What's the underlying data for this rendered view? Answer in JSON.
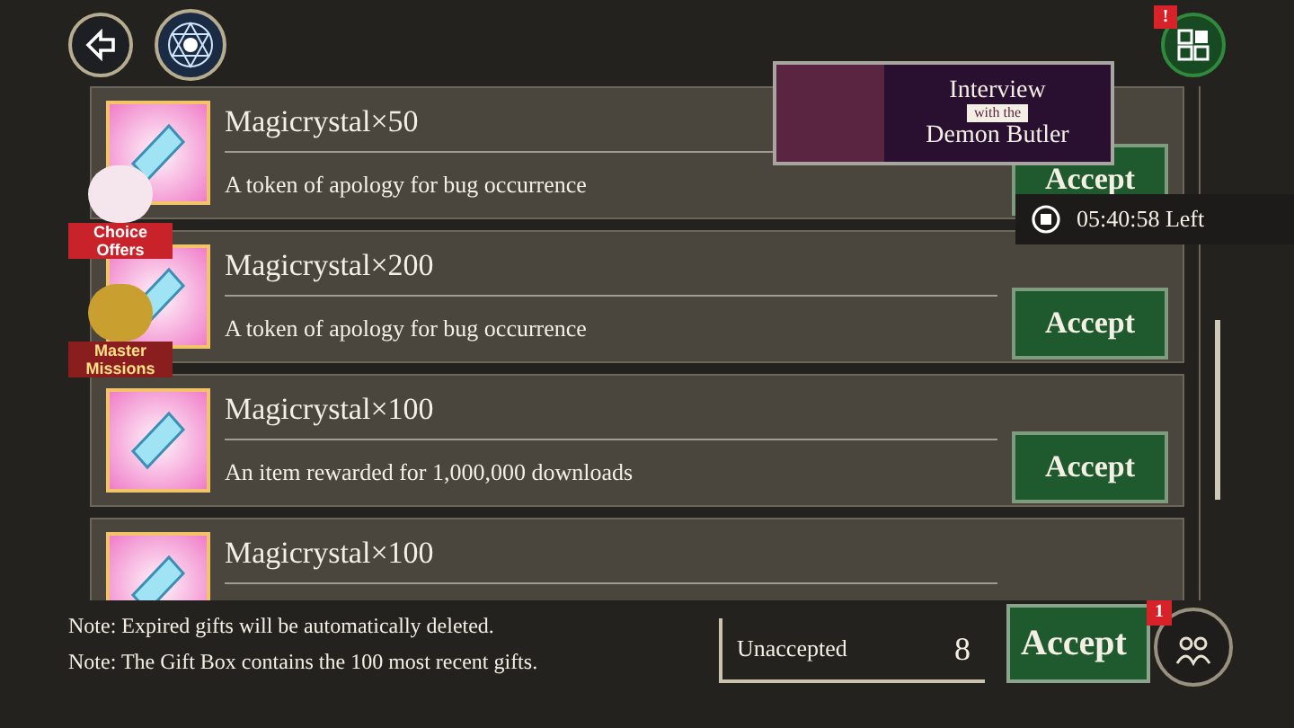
{
  "gifts": [
    {
      "title": "Magicrystal×50",
      "description": "A token of apology for bug occurrence",
      "button": "Accept"
    },
    {
      "title": "Magicrystal×200",
      "description": "A token of apology for bug occurrence",
      "button": "Accept"
    },
    {
      "title": "Magicrystal×100",
      "description": "An item rewarded for 1,000,000 downloads",
      "button": "Accept"
    },
    {
      "title": "Magicrystal×100"
    }
  ],
  "banner": {
    "line_1": "Interview",
    "line_2": "with the",
    "line_3": "Demon Butler"
  },
  "timer": "05:40:58 Left",
  "side_badges": [
    {
      "label": "Choice Offers"
    },
    {
      "label": "Master Missions"
    }
  ],
  "menu_alert": "!",
  "notes": [
    "Note: Expired gifts will be automatically deleted.",
    "Note: The Gift Box contains the 100 most recent gifts."
  ],
  "unaccepted": {
    "label": "Unaccepted",
    "count": "8"
  },
  "accept_all": "Accept",
  "social_alert": "1"
}
